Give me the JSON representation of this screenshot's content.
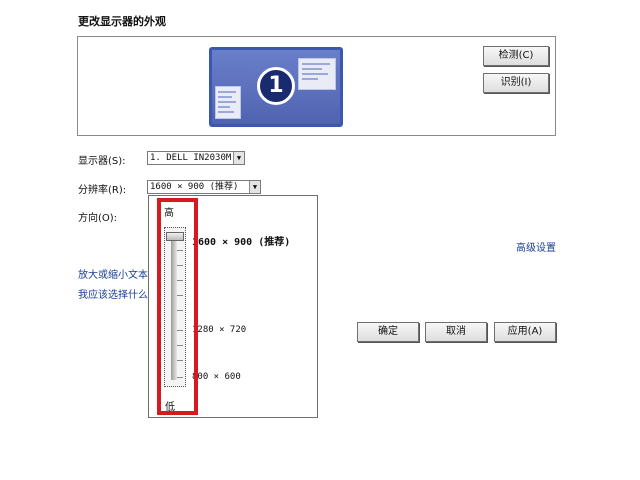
{
  "page": {
    "title": "更改显示器的外观"
  },
  "preview": {
    "monitor_number": "1",
    "detect_button": "检测(C)",
    "identify_button": "识别(I)"
  },
  "form": {
    "display_label": "显示器(S):",
    "display_value": "1. DELL IN2030M",
    "resolution_label": "分辨率(R):",
    "resolution_value": "1600 × 900 (推荐)",
    "orientation_label": "方向(O):"
  },
  "links": {
    "advanced_settings": "高级设置",
    "text_size": "放大或缩小文本",
    "which_settings": "我应该选择什么"
  },
  "resolution_dropdown": {
    "high_label": "高",
    "low_label": "低",
    "options": [
      {
        "label": "1600 × 900 (推荐)",
        "recommended": true
      },
      {
        "label": "1280 × 720"
      },
      {
        "label": "800 × 600"
      }
    ],
    "selected_index": 0,
    "highlight_color": "#d71920"
  },
  "buttons": {
    "ok": "确定",
    "cancel": "取消",
    "apply": "应用(A)"
  }
}
